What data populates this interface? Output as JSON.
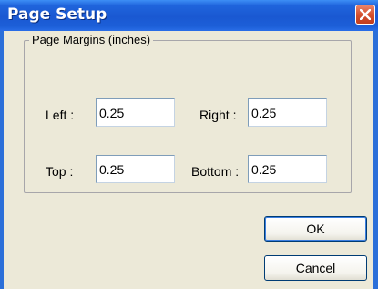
{
  "window": {
    "title": "Page Setup"
  },
  "margins": {
    "group_label": "Page Margins (inches)",
    "left": {
      "label": "Left :",
      "value": "0.25"
    },
    "right": {
      "label": "Right :",
      "value": "0.25"
    },
    "top": {
      "label": "Top :",
      "value": "0.25"
    },
    "bottom": {
      "label": "Bottom :",
      "value": "0.25"
    }
  },
  "buttons": {
    "ok": "OK",
    "cancel": "Cancel"
  },
  "icons": {
    "close": "close-icon"
  },
  "colors": {
    "titlebar": "#1a58d2",
    "close_button": "#d5502f",
    "dialog_face": "#ece9d8"
  }
}
